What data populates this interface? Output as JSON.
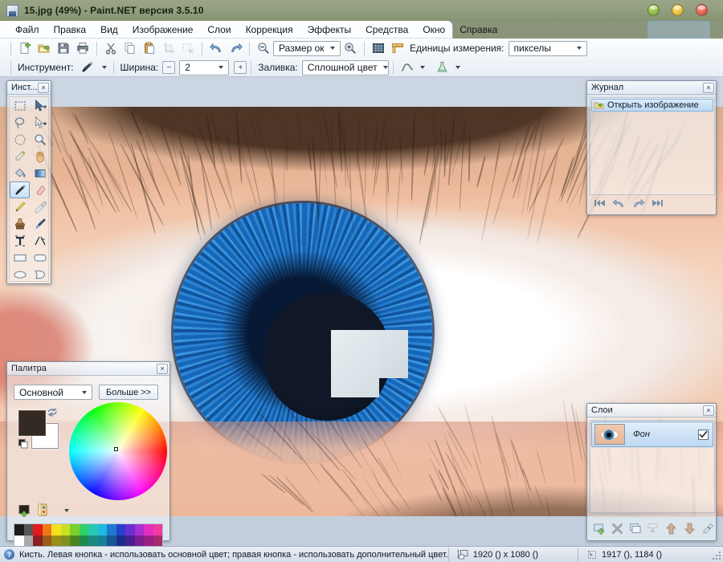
{
  "window": {
    "title": "15.jpg (49%) - Paint.NET версия 3.5.10",
    "app_icon": "paintnet-icon",
    "controls": {
      "minimize": "minimize-button",
      "maximize": "maximize-button",
      "close": "close-button"
    }
  },
  "menu": {
    "items": [
      {
        "label": "Файл"
      },
      {
        "label": "Правка"
      },
      {
        "label": "Вид"
      },
      {
        "label": "Изображение"
      },
      {
        "label": "Слои"
      },
      {
        "label": "Коррекция"
      },
      {
        "label": "Эффекты"
      },
      {
        "label": "Средства"
      },
      {
        "label": "Окно"
      },
      {
        "label": "Справка"
      }
    ]
  },
  "toolbar": {
    "main_buttons": [
      {
        "name": "new-image",
        "icon": "new-document-icon"
      },
      {
        "name": "open-image",
        "icon": "open-folder-icon"
      },
      {
        "name": "save-image",
        "icon": "save-disk-icon"
      },
      {
        "name": "print-image",
        "icon": "printer-icon"
      },
      {
        "name": "cut",
        "icon": "scissors-icon"
      },
      {
        "name": "copy",
        "icon": "copy-icon"
      },
      {
        "name": "paste",
        "icon": "clipboard-paste-icon"
      },
      {
        "name": "crop-selection",
        "icon": "crop-icon"
      },
      {
        "name": "deselect-all",
        "icon": "deselect-icon"
      },
      {
        "name": "undo",
        "icon": "undo-arrow-icon"
      },
      {
        "name": "redo",
        "icon": "redo-arrow-icon"
      },
      {
        "name": "zoom-out",
        "icon": "zoom-out-icon"
      },
      {
        "name": "zoom-in",
        "icon": "zoom-in-icon"
      },
      {
        "name": "toggle-grid",
        "icon": "grid-icon"
      },
      {
        "name": "toggle-rulers",
        "icon": "ruler-icon"
      }
    ],
    "zoom_combo_value": "Размер ок",
    "units_label": "Единицы измерения:",
    "units_value": "пикселы",
    "tool_label": "Инструмент:",
    "tool_icon": "paintbrush-icon",
    "width_label": "Ширина:",
    "width_value": "2",
    "width_decrease": "−",
    "width_increase": "+",
    "fill_label": "Заливка:",
    "fill_value": "Сплошной цвет",
    "antialias_icon": "antialias-curve-icon",
    "blend_icon": "blend-flask-icon"
  },
  "tools_panel": {
    "title": "Инст...",
    "close": "×",
    "tools": [
      {
        "name": "rectangle-select-tool",
        "icon": "dashed-rectangle-icon",
        "selected": false
      },
      {
        "name": "move-selected-tool",
        "icon": "move-arrow-icon",
        "selected": false
      },
      {
        "name": "lasso-select-tool",
        "icon": "lasso-icon",
        "selected": false
      },
      {
        "name": "move-selection-tool",
        "icon": "move-selection-icon",
        "selected": false
      },
      {
        "name": "ellipse-select-tool",
        "icon": "dotted-ellipse-icon",
        "selected": false
      },
      {
        "name": "zoom-tool",
        "icon": "magnifier-icon",
        "selected": false
      },
      {
        "name": "magic-wand-tool",
        "icon": "magic-wand-icon",
        "selected": false
      },
      {
        "name": "pan-tool",
        "icon": "hand-icon",
        "selected": false
      },
      {
        "name": "paint-bucket-tool",
        "icon": "paint-bucket-icon",
        "selected": false
      },
      {
        "name": "gradient-tool",
        "icon": "gradient-icon",
        "selected": false
      },
      {
        "name": "paintbrush-tool",
        "icon": "paintbrush-icon",
        "selected": true
      },
      {
        "name": "eraser-tool",
        "icon": "eraser-icon",
        "selected": false
      },
      {
        "name": "pencil-tool",
        "icon": "pencil-icon",
        "selected": false
      },
      {
        "name": "color-picker-tool",
        "icon": "eyedropper-icon",
        "selected": false
      },
      {
        "name": "clone-stamp-tool",
        "icon": "stamp-icon",
        "selected": false
      },
      {
        "name": "recolor-tool",
        "icon": "recolor-brush-icon",
        "selected": false
      },
      {
        "name": "text-tool",
        "icon": "text-t-icon",
        "selected": false
      },
      {
        "name": "line-curve-tool",
        "icon": "line-curve-icon",
        "selected": false
      },
      {
        "name": "rectangle-tool",
        "icon": "rectangle-shape-icon",
        "selected": false
      },
      {
        "name": "rounded-rect-tool",
        "icon": "rounded-rect-icon",
        "selected": false
      },
      {
        "name": "ellipse-tool",
        "icon": "ellipse-shape-icon",
        "selected": false
      },
      {
        "name": "freeform-shape-tool",
        "icon": "freeform-shape-icon",
        "selected": false
      }
    ]
  },
  "history_panel": {
    "title": "Журнал",
    "close": "×",
    "entries": [
      {
        "label": "Открыть изображение",
        "icon": "open-image-icon",
        "selected": true
      }
    ],
    "nav_buttons": [
      {
        "name": "history-rewind-all",
        "icon": "skip-back-icon"
      },
      {
        "name": "history-undo",
        "icon": "undo-arrow-icon"
      },
      {
        "name": "history-redo",
        "icon": "redo-arrow-icon"
      },
      {
        "name": "history-forward-all",
        "icon": "skip-forward-icon"
      }
    ]
  },
  "palette_panel": {
    "title": "Палитра",
    "close": "×",
    "mode_value": "Основной",
    "more_label": "Больше >>",
    "primary_color": "#332b23",
    "secondary_color": "#ffffff",
    "swap_icon": "swap-colors-icon",
    "reset_icon": "reset-colors-icon",
    "add_color_icon": "add-palette-color-icon",
    "palette_menu_icon": "palette-dropdown-icon",
    "swatches_row1": [
      "#1c1c1c",
      "#555555",
      "#e01b1b",
      "#f07818",
      "#f5e020",
      "#c8e020",
      "#79d02a",
      "#2fcf6a",
      "#24c8b4",
      "#1eb8e0",
      "#1f78d0",
      "#2440c8",
      "#6b2fd0",
      "#a82fd0",
      "#e02fc0",
      "#ef3aa0"
    ],
    "swatches_row2": [
      "#ffffff",
      "#a8a8a8",
      "#8a2020",
      "#9a5a18",
      "#9a8f18",
      "#7f9220",
      "#4c8520",
      "#1f8a48",
      "#1a8a80",
      "#167f9a",
      "#175690",
      "#1a2d8a",
      "#4a1f90",
      "#7a1f90",
      "#9a1f85",
      "#a82a70"
    ]
  },
  "layers_panel": {
    "title": "Слои",
    "close": "×",
    "layers": [
      {
        "name": "Фон",
        "visible": true,
        "checkmark": "✓",
        "thumbnail": "layer-thumbnail-eye",
        "selected": true
      }
    ],
    "buttons": [
      {
        "name": "add-layer-button",
        "icon": "add-layer-icon"
      },
      {
        "name": "delete-layer-button",
        "icon": "delete-layer-x-icon"
      },
      {
        "name": "duplicate-layer-button",
        "icon": "duplicate-layer-icon"
      },
      {
        "name": "merge-layer-down-button",
        "icon": "merge-down-icon"
      },
      {
        "name": "move-layer-up-button",
        "icon": "arrow-up-icon"
      },
      {
        "name": "move-layer-down-button",
        "icon": "arrow-down-icon"
      },
      {
        "name": "layer-properties-button",
        "icon": "layer-properties-icon"
      }
    ]
  },
  "statusbar": {
    "help_icon": "info-circle-icon",
    "help_text": "Кисть. Левая кнопка - использовать основной цвет; правая кнопка - использовать дополнительный цвет.",
    "size_icon": "image-size-icon",
    "size_text": "1920 () x 1080 ()",
    "position_icon": "cursor-position-icon",
    "position_text": "1917 (), 1184 ()"
  },
  "canvas": {
    "image_name": "15.jpg",
    "zoom_percent": "49%",
    "thumbnail": "eye-photo-thumbnail"
  }
}
